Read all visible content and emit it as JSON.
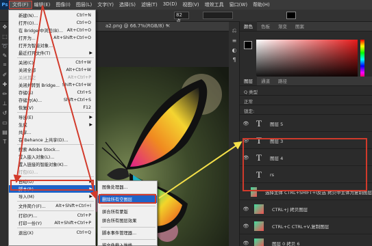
{
  "app": {
    "logo": "Ps"
  },
  "menubar": [
    {
      "label": "文件(F)",
      "active": true
    },
    {
      "label": "编辑(E)"
    },
    {
      "label": "图像(I)"
    },
    {
      "label": "图层(L)"
    },
    {
      "label": "文字(Y)"
    },
    {
      "label": "选择(S)"
    },
    {
      "label": "滤镜(T)"
    },
    {
      "label": "3D(D)"
    },
    {
      "label": "视图(V)"
    },
    {
      "label": "增效工具"
    },
    {
      "label": "窗口(W)"
    },
    {
      "label": "帮助(H)"
    }
  ],
  "options": {
    "font_size": "82 点"
  },
  "document": {
    "tab_title": "a2.png @ 66.7%(RGB/8) *",
    "canvas_letter": "S"
  },
  "file_menu": [
    {
      "label": "新建(N)...",
      "shortcut": "Ctrl+N"
    },
    {
      "label": "打开(O)...",
      "shortcut": "Ctrl+O"
    },
    {
      "label": "在 Bridge 中浏览(B)...",
      "shortcut": "Alt+Ctrl+O"
    },
    {
      "label": "打开为...",
      "shortcut": "Alt+Shift+Ctrl+O"
    },
    {
      "label": "打开为智能对象..."
    },
    {
      "label": "最近打开文件(T)",
      "submenu": true
    },
    {
      "sep": true
    },
    {
      "label": "关闭(C)",
      "shortcut": "Ctrl+W"
    },
    {
      "label": "关闭全部",
      "shortcut": "Alt+Ctrl+W"
    },
    {
      "label": "关闭其它",
      "shortcut": "Alt+Ctrl+P",
      "disabled": true
    },
    {
      "label": "关闭并转到 Bridge...",
      "shortcut": "Shift+Ctrl+W"
    },
    {
      "label": "存储(S)",
      "shortcut": "Ctrl+S"
    },
    {
      "label": "存储为(A)...",
      "shortcut": "Shift+Ctrl+S"
    },
    {
      "label": "恢复(V)",
      "shortcut": "F12"
    },
    {
      "sep": true
    },
    {
      "label": "导出(E)",
      "submenu": true
    },
    {
      "label": "生成",
      "submenu": true
    },
    {
      "label": "共享..."
    },
    {
      "label": "在 Behance 上共享(D)..."
    },
    {
      "sep": true
    },
    {
      "label": "搜索 Adobe Stock..."
    },
    {
      "label": "置入嵌入对象(L)..."
    },
    {
      "label": "置入链接的智能对象(K)..."
    },
    {
      "label": "打包(G)...",
      "disabled": true
    },
    {
      "sep": true
    },
    {
      "label": "自动(U)",
      "submenu": true
    },
    {
      "label": "脚本(R)",
      "submenu": true,
      "highlighted": true
    },
    {
      "label": "导入(M)",
      "submenu": true
    },
    {
      "sep": true
    },
    {
      "label": "文件简介(F)...",
      "shortcut": "Alt+Shift+Ctrl+I"
    },
    {
      "sep": true
    },
    {
      "label": "打印(P)...",
      "shortcut": "Ctrl+P"
    },
    {
      "label": "打印一份(Y)",
      "shortcut": "Alt+Shift+Ctrl+P"
    },
    {
      "sep": true
    },
    {
      "label": "退出(X)",
      "shortcut": "Ctrl+Q"
    }
  ],
  "scripts_submenu": [
    {
      "label": "图像处理器..."
    },
    {
      "sep": true
    },
    {
      "label": "删除所有空图层",
      "highlighted": true
    },
    {
      "sep": true
    },
    {
      "label": "拼合所有蒙版"
    },
    {
      "label": "拼合所有图层效果"
    },
    {
      "sep": true
    },
    {
      "label": "脚本事件管理器..."
    },
    {
      "sep": true
    },
    {
      "label": "将文件载入堆栈..."
    }
  ],
  "panels": {
    "top_tabs": [
      "颜色",
      "色板",
      "渐变",
      "图案"
    ],
    "layer_tabs": [
      "图层",
      "通道",
      "路径"
    ],
    "filter_label": "Q 类型",
    "mode_label": "正常",
    "lock_label": "锁定:"
  },
  "layers": [
    {
      "type": "text",
      "name": "图层 5",
      "visible": true
    },
    {
      "type": "text",
      "name": "图层 3",
      "visible": true
    },
    {
      "type": "text",
      "name": "图层 4",
      "visible": true
    },
    {
      "type": "text",
      "name": "rs",
      "visible": false
    },
    {
      "type": "image",
      "name": "选择主体 CTRL+SHIFT+I反选 拷贝中主体为复制图层",
      "visible": false
    },
    {
      "type": "image",
      "name": "CTRL+J 拷贝图层",
      "visible": true
    },
    {
      "type": "image",
      "name": "CTRL+C CTRL+V,复制图层",
      "visible": true
    },
    {
      "type": "image",
      "name": "图层 0 拷贝 6",
      "visible": true
    }
  ],
  "colors": {
    "highlight": "#1e63c8",
    "annotation_red": "#d23a2b",
    "annotation_yellow": "#f5e04a"
  }
}
